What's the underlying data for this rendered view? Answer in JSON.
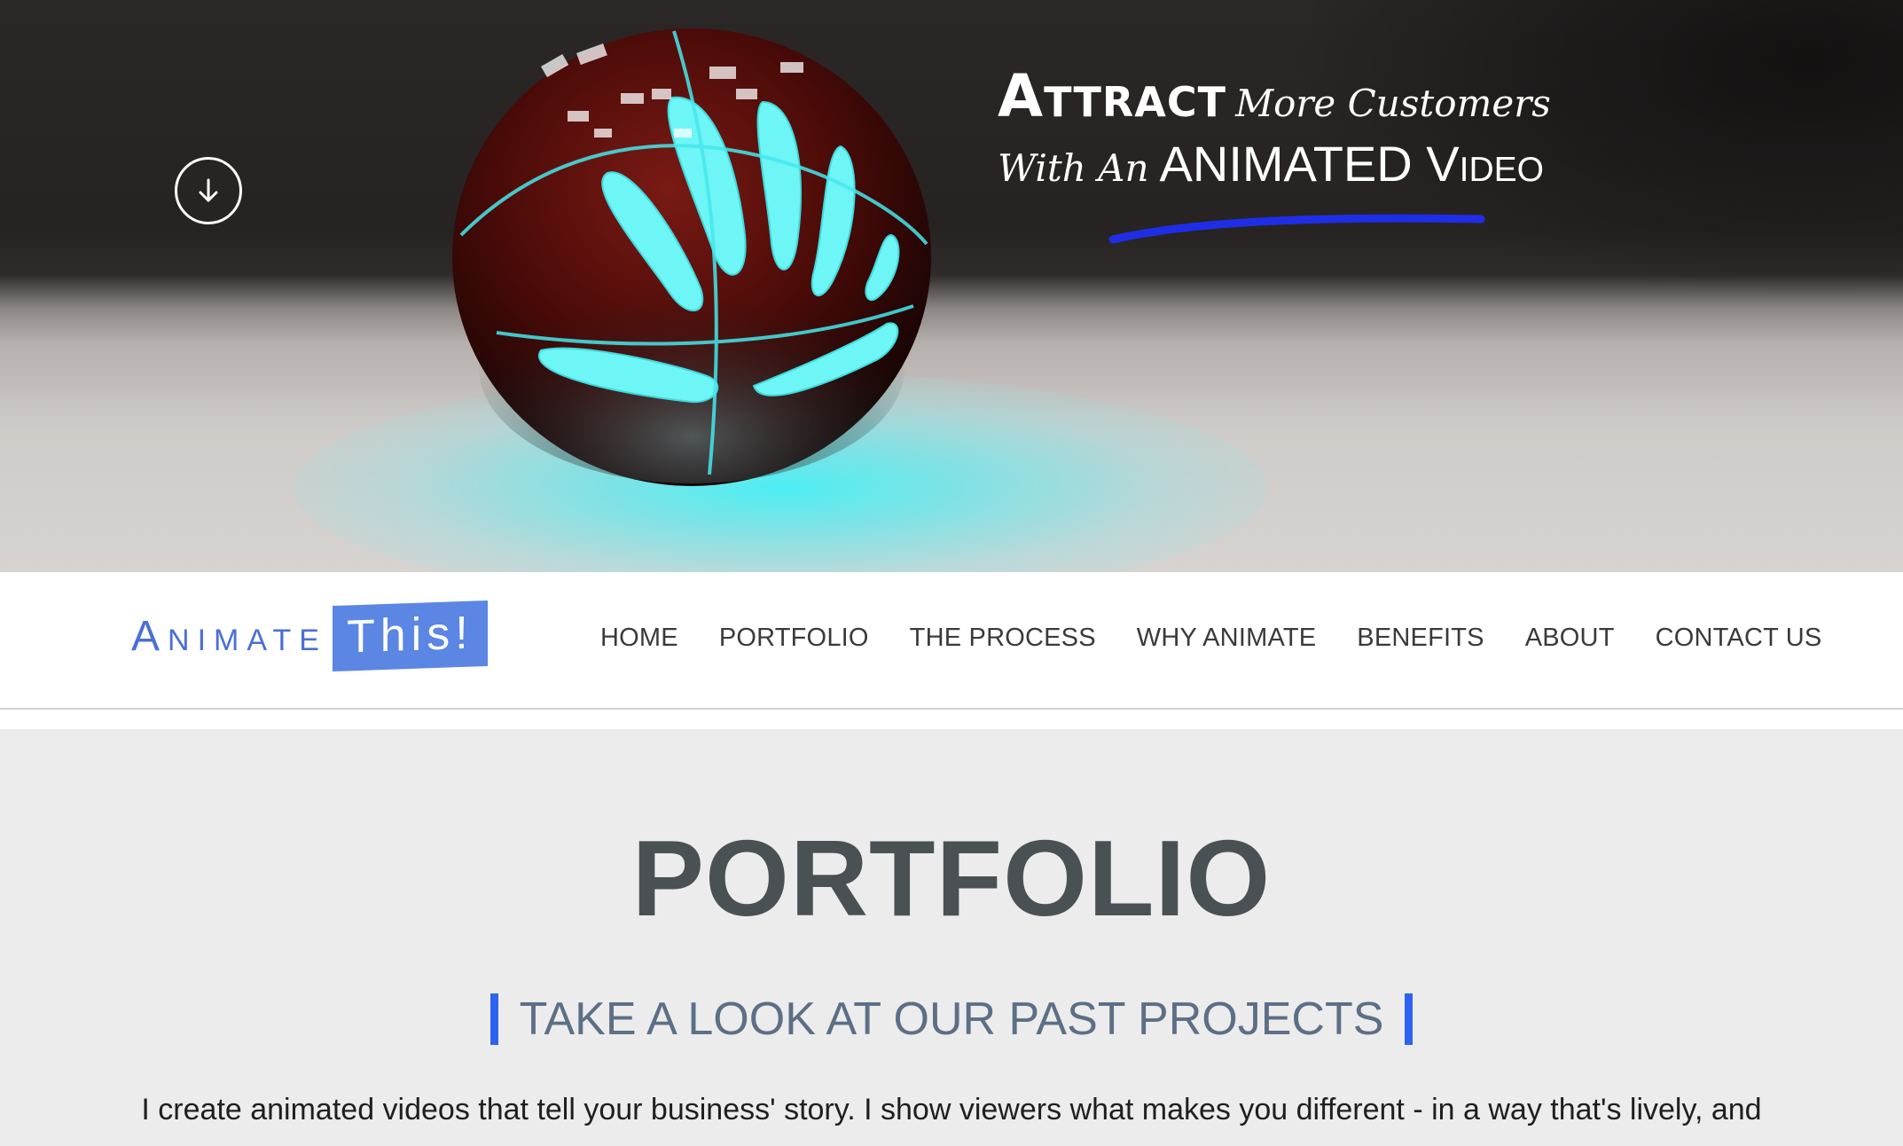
{
  "hero": {
    "headline_bold": "Attract",
    "headline_script_1": "More Customers",
    "headline_script_2": "With An",
    "headline_caps": "ANIMATED Video",
    "scroll_icon": "arrow-down-circle-icon",
    "colors": {
      "orb_body": "#5a0f0c",
      "orb_glow": "#6ef5f5",
      "underline": "#1f2ee6"
    }
  },
  "logo": {
    "animate_text": "Animate",
    "this_text": "This!",
    "colors": {
      "text": "#4a6fd6",
      "box": "#5b86e3"
    }
  },
  "nav": {
    "items": [
      {
        "label": "HOME"
      },
      {
        "label": "PORTFOLIO"
      },
      {
        "label": "THE PROCESS"
      },
      {
        "label": "WHY ANIMATE"
      },
      {
        "label": "BENEFITS"
      },
      {
        "label": "ABOUT"
      },
      {
        "label": "CONTACT US"
      }
    ]
  },
  "portfolio": {
    "title": "PORTFOLIO",
    "subtitle": "TAKE A LOOK AT OUR PAST PROJECTS",
    "intro": "I create animated videos that tell your business' story. I show viewers what makes you different - in a way that's lively, and",
    "colors": {
      "title": "#4a5154",
      "subtitle": "#5c6f86",
      "accent_bar": "#2d63f0"
    }
  }
}
